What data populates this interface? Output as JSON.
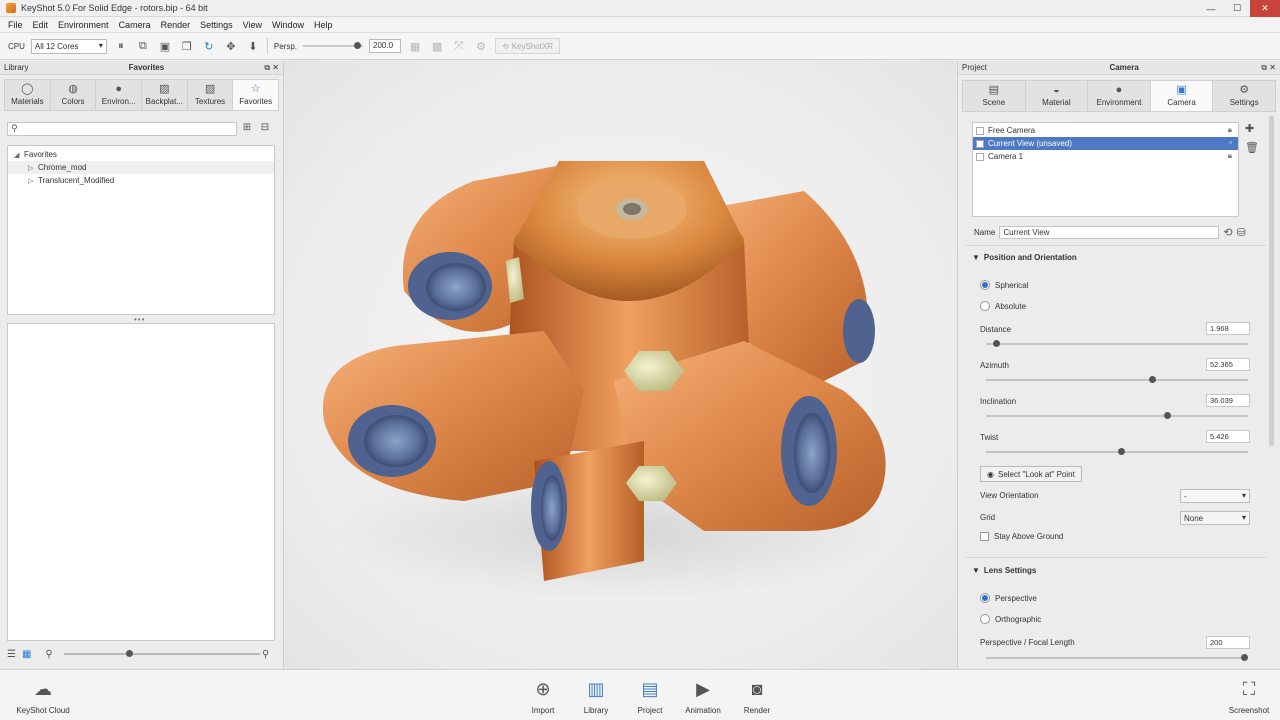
{
  "window": {
    "title": "KeyShot 5.0 For Solid Edge - rotors.bip - 64 bit"
  },
  "menu": [
    "File",
    "Edit",
    "Environment",
    "Camera",
    "Render",
    "Settings",
    "View",
    "Window",
    "Help"
  ],
  "toolbar": {
    "cpu_label": "CPU",
    "cpu_value": "All 12 Cores",
    "persp_label": "Persp.",
    "persp_value": "200.0",
    "keyshotxr_label": "KeyShotXR"
  },
  "library": {
    "panel_left": "Library",
    "panel_title": "Favorites",
    "tabs": [
      {
        "label": "Materials",
        "icon": "sphere-icon"
      },
      {
        "label": "Colors",
        "icon": "palette-icon"
      },
      {
        "label": "Environ...",
        "icon": "globe-icon"
      },
      {
        "label": "Backplat...",
        "icon": "image-icon"
      },
      {
        "label": "Textures",
        "icon": "texture-icon"
      },
      {
        "label": "Favorites",
        "icon": "star-icon"
      }
    ],
    "search_placeholder": "",
    "tree": {
      "root": "Favorites",
      "children": [
        "Chrome_mod",
        "Translucent_Modified"
      ]
    }
  },
  "project": {
    "panel_left": "Project",
    "panel_title": "Camera",
    "tabs": [
      {
        "label": "Scene",
        "icon": "scene-icon"
      },
      {
        "label": "Material",
        "icon": "material-icon"
      },
      {
        "label": "Environment",
        "icon": "environment-icon"
      },
      {
        "label": "Camera",
        "icon": "camera-icon"
      },
      {
        "label": "Settings",
        "icon": "gear-icon"
      }
    ],
    "cameras": [
      "Free Camera",
      "Current View (unsaved)",
      "Camera 1"
    ],
    "name_label": "Name",
    "name_value": "Current View",
    "position_section": "Position and Orientation",
    "spherical": "Spherical",
    "absolute": "Absolute",
    "params": [
      {
        "label": "Distance",
        "value": "1.968",
        "level": 0.03
      },
      {
        "label": "Azimuth",
        "value": "52.365",
        "level": 0.64
      },
      {
        "label": "Inclination",
        "value": "36.039",
        "level": 0.7
      },
      {
        "label": "Twist",
        "value": "5.426",
        "level": 0.52
      }
    ],
    "lookat_label": "Select \"Look at\" Point",
    "view_orientation_label": "View Orientation",
    "view_orientation_value": "-",
    "grid_label": "Grid",
    "grid_value": "None",
    "stay_above_ground": "Stay Above Ground",
    "lens_section": "Lens Settings",
    "perspective": "Perspective",
    "orthographic": "Orthographic",
    "focal_label": "Perspective / Focal Length",
    "focal_value": "200",
    "focal_level": 1.0
  },
  "bottom": {
    "cloud": "KeyShot Cloud",
    "items": [
      "Import",
      "Library",
      "Project",
      "Animation",
      "Render"
    ],
    "screenshot": "Screenshot"
  },
  "colors": {
    "accent": "#2f7bd8",
    "copper": "#e0874a",
    "selection": "#4e79c4",
    "close": "#c8433a"
  }
}
